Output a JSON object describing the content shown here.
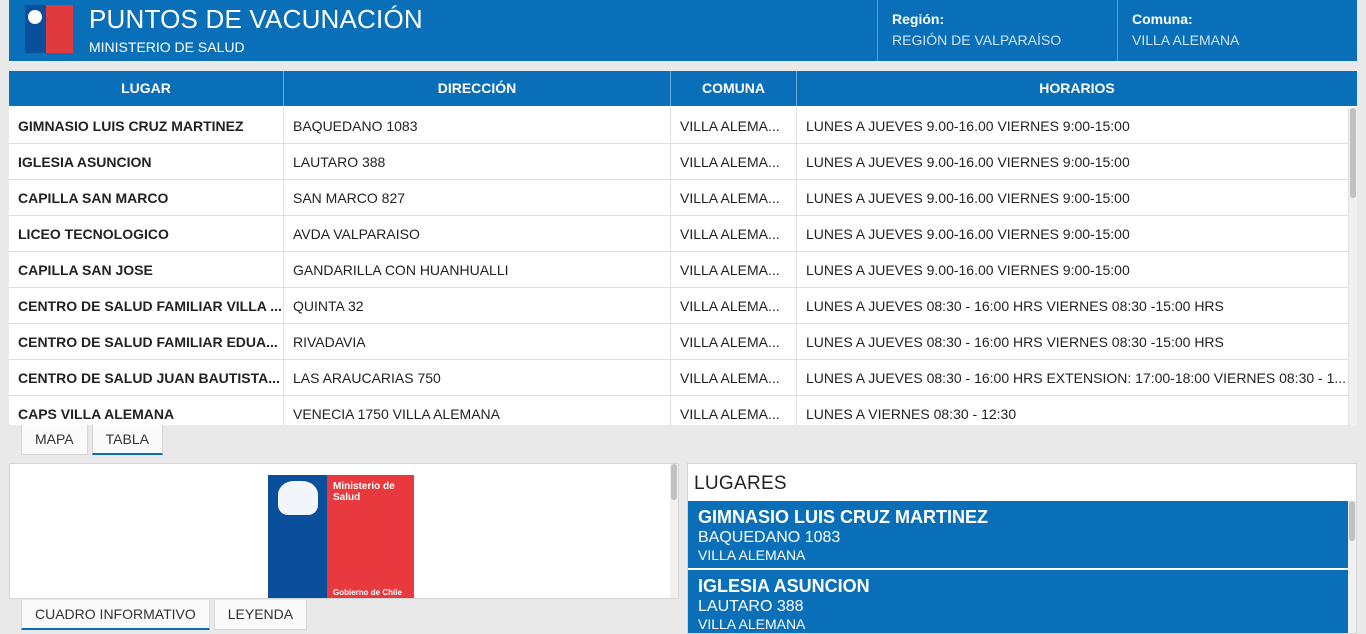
{
  "header": {
    "title": "PUNTOS DE VACUNACIÓN",
    "subtitle": "MINISTERIO DE SALUD",
    "region_label": "Región:",
    "region_value": "REGIÓN DE VALPARAÍSO",
    "comuna_label": "Comuna:",
    "comuna_value": "VILLA ALEMANA"
  },
  "table": {
    "columns": [
      "LUGAR",
      "DIRECCIÓN",
      "COMUNA",
      "HORARIOS"
    ],
    "rows": [
      [
        "GIMNASIO LUIS CRUZ MARTINEZ",
        "BAQUEDANO 1083",
        "VILLA ALEMA...",
        "LUNES A JUEVES 9.00-16.00 VIERNES 9:00-15:00"
      ],
      [
        "IGLESIA ASUNCION",
        "LAUTARO 388",
        "VILLA ALEMA...",
        "LUNES A JUEVES 9.00-16.00 VIERNES 9:00-15:00"
      ],
      [
        "CAPILLA SAN MARCO",
        "SAN MARCO 827",
        "VILLA ALEMA...",
        "LUNES A JUEVES 9.00-16.00 VIERNES 9:00-15:00"
      ],
      [
        "LICEO TECNOLOGICO",
        "AVDA VALPARAISO",
        "VILLA ALEMA...",
        "LUNES A JUEVES 9.00-16.00 VIERNES 9:00-15:00"
      ],
      [
        "CAPILLA SAN JOSE",
        "GANDARILLA CON HUANHUALLI",
        "VILLA ALEMA...",
        "LUNES A JUEVES 9.00-16.00 VIERNES 9:00-15:00"
      ],
      [
        "CENTRO DE SALUD FAMILIAR VILLA ...",
        "QUINTA 32",
        "VILLA ALEMA...",
        "LUNES A JUEVES 08:30 - 16:00 HRS VIERNES 08:30 -15:00 HRS"
      ],
      [
        "CENTRO DE SALUD FAMILIAR EDUA...",
        "RIVADAVIA",
        "VILLA ALEMA...",
        "LUNES A JUEVES 08:30 - 16:00 HRS VIERNES 08:30 -15:00 HRS"
      ],
      [
        "CENTRO DE SALUD JUAN BAUTISTA...",
        "LAS ARAUCARIAS 750",
        "VILLA ALEMA...",
        "LUNES A JUEVES 08:30 - 16:00 HRS EXTENSION: 17:00-18:00 VIERNES 08:30 - 1..."
      ],
      [
        "CAPS VILLA ALEMANA",
        "VENECIA 1750 VILLA ALEMANA",
        "VILLA ALEMA...",
        "LUNES A VIERNES 08:30 - 12:30"
      ]
    ]
  },
  "view_tabs": [
    "MAPA",
    "TABLA"
  ],
  "info_panel": {
    "logo_text": "Ministerio de Salud",
    "logo_footer": "Gobierno de Chile"
  },
  "panel_tabs": [
    "CUADRO INFORMATIVO",
    "LEYENDA"
  ],
  "lugares": {
    "heading": "LUGARES",
    "items": [
      {
        "name": "GIMNASIO LUIS CRUZ MARTINEZ",
        "address": "BAQUEDANO 1083",
        "comuna": "VILLA ALEMANA"
      },
      {
        "name": "IGLESIA ASUNCION",
        "address": "LAUTARO 388",
        "comuna": "VILLA ALEMANA"
      }
    ]
  },
  "colors": {
    "brand_blue": "#0a6fb9",
    "logo_blue": "#0a4f9b",
    "logo_red": "#e8393f"
  }
}
